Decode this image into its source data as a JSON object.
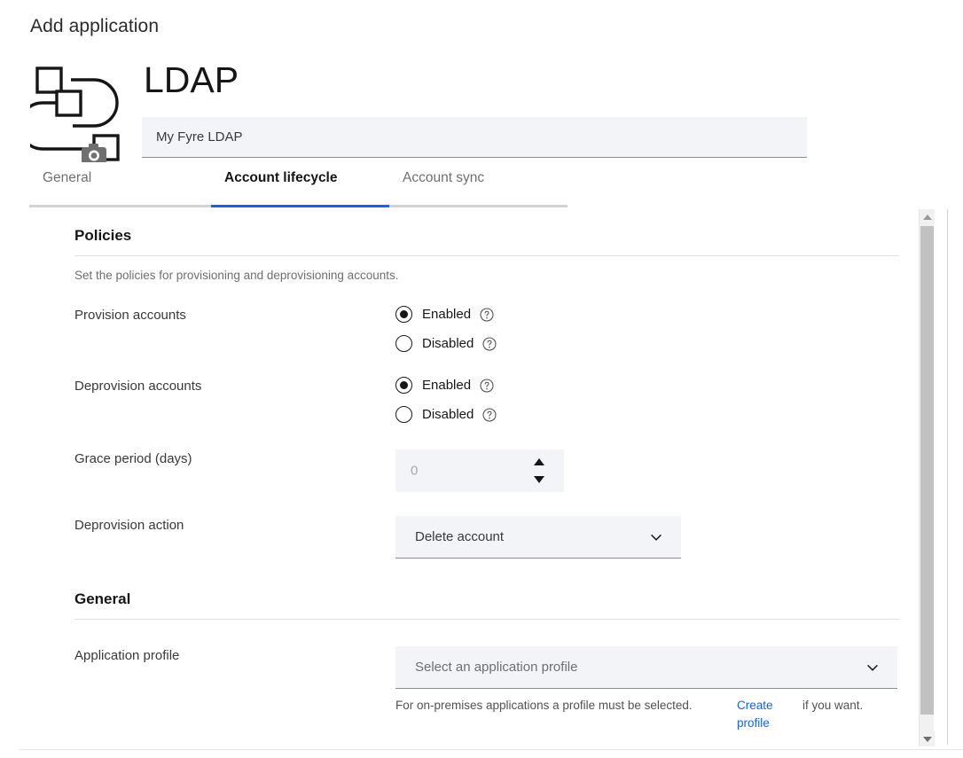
{
  "page": {
    "title": "Add application"
  },
  "app": {
    "name": "LDAP",
    "logo_icon": "application-flow-camera-icon",
    "name_field": {
      "value": "My Fyre LDAP",
      "placeholder": "My Fyre LDAP"
    }
  },
  "tabs": [
    {
      "label": "General",
      "active": false
    },
    {
      "label": "Account lifecycle",
      "active": true
    },
    {
      "label": "Account sync",
      "active": false
    }
  ],
  "policies": {
    "heading": "Policies",
    "description": "Set the policies for provisioning and deprovisioning accounts.",
    "provision": {
      "label": "Provision accounts",
      "options": [
        {
          "label": "Enabled",
          "selected": true,
          "help_icon": "help-circle-icon"
        },
        {
          "label": "Disabled",
          "selected": false,
          "help_icon": "help-circle-icon"
        }
      ]
    },
    "deprovision": {
      "label": "Deprovision accounts",
      "options": [
        {
          "label": "Enabled",
          "selected": true,
          "help_icon": "help-circle-icon"
        },
        {
          "label": "Disabled",
          "selected": false,
          "help_icon": "help-circle-icon"
        }
      ]
    },
    "grace_period": {
      "label": "Grace period (days)",
      "value": "0",
      "placeholder": "0",
      "stepper_up_icon": "caret-up-icon",
      "stepper_down_icon": "caret-down-icon"
    },
    "deprovision_action": {
      "label": "Deprovision action",
      "value": "Delete account",
      "chevron_icon": "chevron-down-icon"
    }
  },
  "general": {
    "heading": "General",
    "application_profile": {
      "label": "Application profile",
      "value": "Select an application profile",
      "chevron_icon": "chevron-down-icon",
      "helper_main": "For on-premises applications a profile must be selected.",
      "helper_link": "Create profile",
      "helper_tail": "if you want."
    }
  },
  "scrollbar": {
    "up_icon": "scroll-up-arrow-icon",
    "down_icon": "scroll-down-arrow-icon"
  },
  "colors": {
    "accent": "#0f62fe",
    "field_bg": "#f2f4f8",
    "text": "#161616",
    "muted": "#6f6f6f"
  }
}
